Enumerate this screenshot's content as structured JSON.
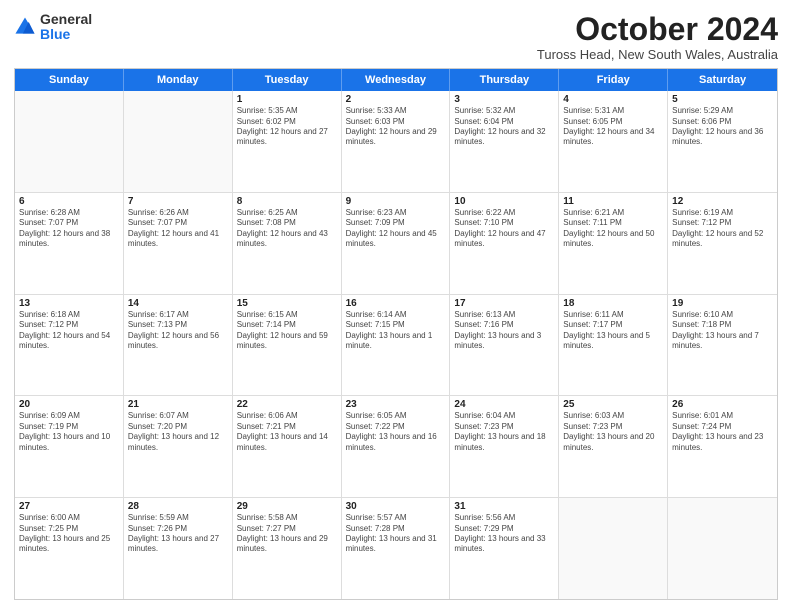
{
  "logo": {
    "general": "General",
    "blue": "Blue"
  },
  "title": "October 2024",
  "subtitle": "Tuross Head, New South Wales, Australia",
  "days": [
    "Sunday",
    "Monday",
    "Tuesday",
    "Wednesday",
    "Thursday",
    "Friday",
    "Saturday"
  ],
  "rows": [
    [
      {
        "day": "",
        "empty": true
      },
      {
        "day": "",
        "empty": true
      },
      {
        "day": "1",
        "sunrise": "Sunrise: 5:35 AM",
        "sunset": "Sunset: 6:02 PM",
        "daylight": "Daylight: 12 hours and 27 minutes."
      },
      {
        "day": "2",
        "sunrise": "Sunrise: 5:33 AM",
        "sunset": "Sunset: 6:03 PM",
        "daylight": "Daylight: 12 hours and 29 minutes."
      },
      {
        "day": "3",
        "sunrise": "Sunrise: 5:32 AM",
        "sunset": "Sunset: 6:04 PM",
        "daylight": "Daylight: 12 hours and 32 minutes."
      },
      {
        "day": "4",
        "sunrise": "Sunrise: 5:31 AM",
        "sunset": "Sunset: 6:05 PM",
        "daylight": "Daylight: 12 hours and 34 minutes."
      },
      {
        "day": "5",
        "sunrise": "Sunrise: 5:29 AM",
        "sunset": "Sunset: 6:06 PM",
        "daylight": "Daylight: 12 hours and 36 minutes."
      }
    ],
    [
      {
        "day": "6",
        "sunrise": "Sunrise: 6:28 AM",
        "sunset": "Sunset: 7:07 PM",
        "daylight": "Daylight: 12 hours and 38 minutes."
      },
      {
        "day": "7",
        "sunrise": "Sunrise: 6:26 AM",
        "sunset": "Sunset: 7:07 PM",
        "daylight": "Daylight: 12 hours and 41 minutes."
      },
      {
        "day": "8",
        "sunrise": "Sunrise: 6:25 AM",
        "sunset": "Sunset: 7:08 PM",
        "daylight": "Daylight: 12 hours and 43 minutes."
      },
      {
        "day": "9",
        "sunrise": "Sunrise: 6:23 AM",
        "sunset": "Sunset: 7:09 PM",
        "daylight": "Daylight: 12 hours and 45 minutes."
      },
      {
        "day": "10",
        "sunrise": "Sunrise: 6:22 AM",
        "sunset": "Sunset: 7:10 PM",
        "daylight": "Daylight: 12 hours and 47 minutes."
      },
      {
        "day": "11",
        "sunrise": "Sunrise: 6:21 AM",
        "sunset": "Sunset: 7:11 PM",
        "daylight": "Daylight: 12 hours and 50 minutes."
      },
      {
        "day": "12",
        "sunrise": "Sunrise: 6:19 AM",
        "sunset": "Sunset: 7:12 PM",
        "daylight": "Daylight: 12 hours and 52 minutes."
      }
    ],
    [
      {
        "day": "13",
        "sunrise": "Sunrise: 6:18 AM",
        "sunset": "Sunset: 7:12 PM",
        "daylight": "Daylight: 12 hours and 54 minutes."
      },
      {
        "day": "14",
        "sunrise": "Sunrise: 6:17 AM",
        "sunset": "Sunset: 7:13 PM",
        "daylight": "Daylight: 12 hours and 56 minutes."
      },
      {
        "day": "15",
        "sunrise": "Sunrise: 6:15 AM",
        "sunset": "Sunset: 7:14 PM",
        "daylight": "Daylight: 12 hours and 59 minutes."
      },
      {
        "day": "16",
        "sunrise": "Sunrise: 6:14 AM",
        "sunset": "Sunset: 7:15 PM",
        "daylight": "Daylight: 13 hours and 1 minute."
      },
      {
        "day": "17",
        "sunrise": "Sunrise: 6:13 AM",
        "sunset": "Sunset: 7:16 PM",
        "daylight": "Daylight: 13 hours and 3 minutes."
      },
      {
        "day": "18",
        "sunrise": "Sunrise: 6:11 AM",
        "sunset": "Sunset: 7:17 PM",
        "daylight": "Daylight: 13 hours and 5 minutes."
      },
      {
        "day": "19",
        "sunrise": "Sunrise: 6:10 AM",
        "sunset": "Sunset: 7:18 PM",
        "daylight": "Daylight: 13 hours and 7 minutes."
      }
    ],
    [
      {
        "day": "20",
        "sunrise": "Sunrise: 6:09 AM",
        "sunset": "Sunset: 7:19 PM",
        "daylight": "Daylight: 13 hours and 10 minutes."
      },
      {
        "day": "21",
        "sunrise": "Sunrise: 6:07 AM",
        "sunset": "Sunset: 7:20 PM",
        "daylight": "Daylight: 13 hours and 12 minutes."
      },
      {
        "day": "22",
        "sunrise": "Sunrise: 6:06 AM",
        "sunset": "Sunset: 7:21 PM",
        "daylight": "Daylight: 13 hours and 14 minutes."
      },
      {
        "day": "23",
        "sunrise": "Sunrise: 6:05 AM",
        "sunset": "Sunset: 7:22 PM",
        "daylight": "Daylight: 13 hours and 16 minutes."
      },
      {
        "day": "24",
        "sunrise": "Sunrise: 6:04 AM",
        "sunset": "Sunset: 7:23 PM",
        "daylight": "Daylight: 13 hours and 18 minutes."
      },
      {
        "day": "25",
        "sunrise": "Sunrise: 6:03 AM",
        "sunset": "Sunset: 7:23 PM",
        "daylight": "Daylight: 13 hours and 20 minutes."
      },
      {
        "day": "26",
        "sunrise": "Sunrise: 6:01 AM",
        "sunset": "Sunset: 7:24 PM",
        "daylight": "Daylight: 13 hours and 23 minutes."
      }
    ],
    [
      {
        "day": "27",
        "sunrise": "Sunrise: 6:00 AM",
        "sunset": "Sunset: 7:25 PM",
        "daylight": "Daylight: 13 hours and 25 minutes."
      },
      {
        "day": "28",
        "sunrise": "Sunrise: 5:59 AM",
        "sunset": "Sunset: 7:26 PM",
        "daylight": "Daylight: 13 hours and 27 minutes."
      },
      {
        "day": "29",
        "sunrise": "Sunrise: 5:58 AM",
        "sunset": "Sunset: 7:27 PM",
        "daylight": "Daylight: 13 hours and 29 minutes."
      },
      {
        "day": "30",
        "sunrise": "Sunrise: 5:57 AM",
        "sunset": "Sunset: 7:28 PM",
        "daylight": "Daylight: 13 hours and 31 minutes."
      },
      {
        "day": "31",
        "sunrise": "Sunrise: 5:56 AM",
        "sunset": "Sunset: 7:29 PM",
        "daylight": "Daylight: 13 hours and 33 minutes."
      },
      {
        "day": "",
        "empty": true
      },
      {
        "day": "",
        "empty": true
      }
    ]
  ]
}
